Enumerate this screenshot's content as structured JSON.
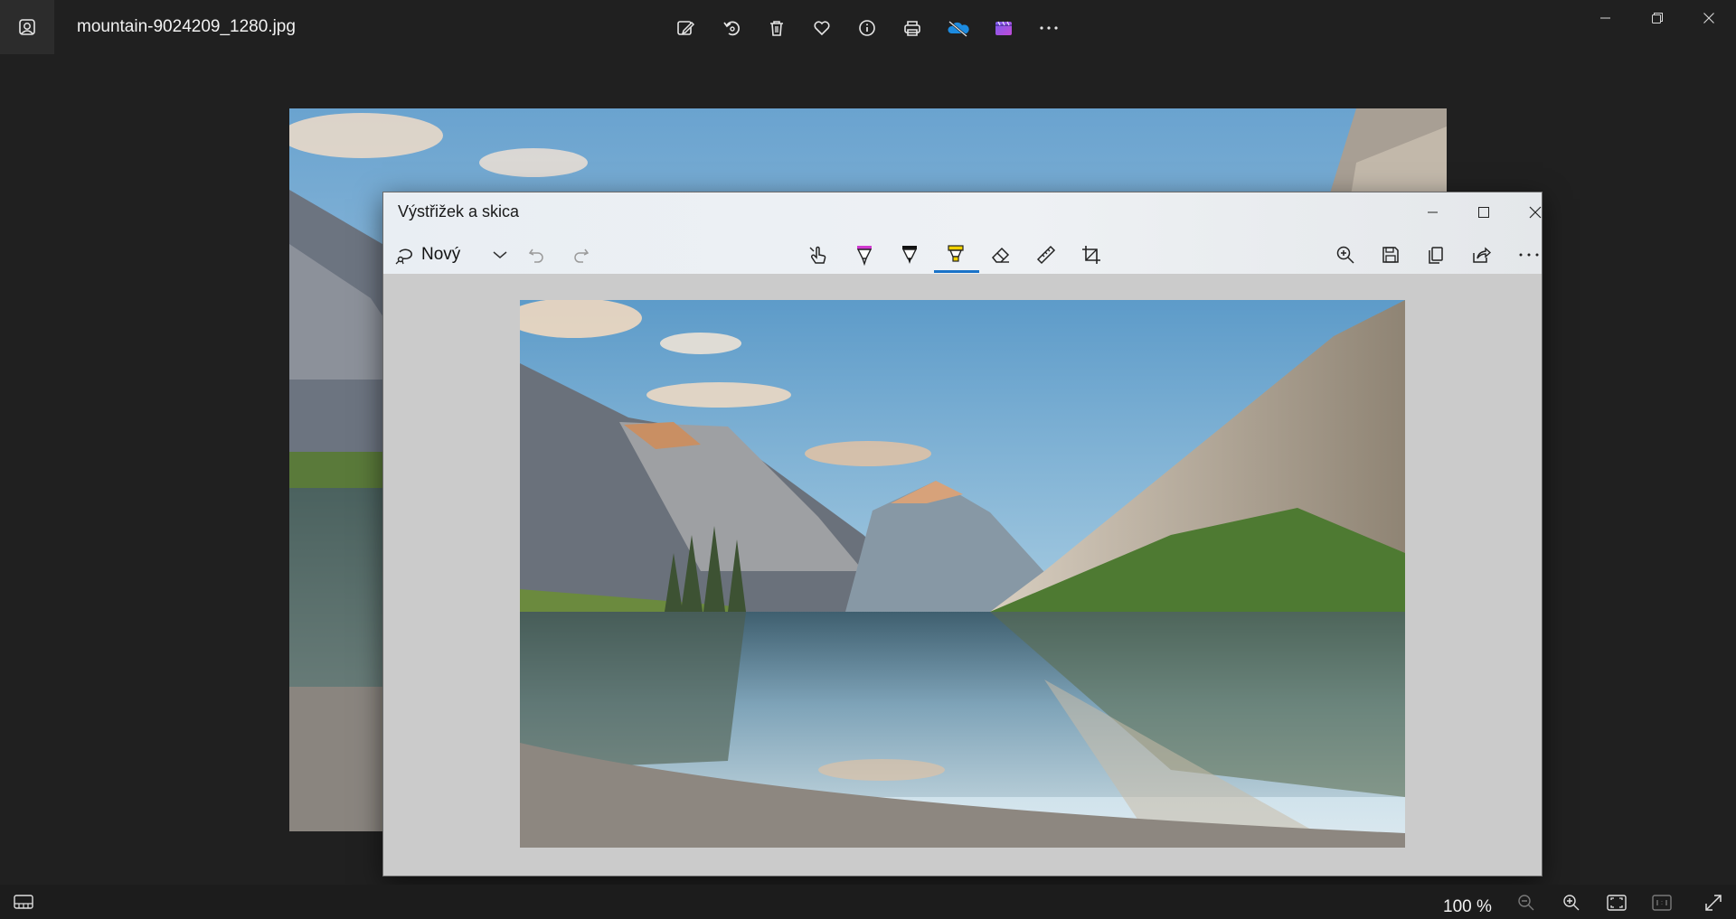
{
  "photos": {
    "file_name": "mountain-9024209_1280.jpg",
    "toolbar": [
      {
        "icon": "edit-image-icon"
      },
      {
        "icon": "rotate-icon"
      },
      {
        "icon": "delete-icon"
      },
      {
        "icon": "favorite-icon"
      },
      {
        "icon": "info-icon"
      },
      {
        "icon": "print-icon"
      },
      {
        "icon": "onedrive-icon"
      },
      {
        "icon": "clipchamp-icon"
      },
      {
        "icon": "more-icon"
      }
    ],
    "window_controls": [
      "minimize-icon",
      "restore-icon",
      "close-icon"
    ],
    "zoom_level": "100 %",
    "accent_onedrive": "#1c8be0"
  },
  "snip": {
    "title": "Výstřižek a skica",
    "new_label": "Nový",
    "tools_left": [
      "undo-icon",
      "redo-icon"
    ],
    "tools_center": [
      "touch-writing-icon",
      "ballpoint-pen-icon",
      "pencil-icon",
      "highlighter-icon",
      "eraser-icon",
      "ruler-icon",
      "crop-icon"
    ],
    "tools_right": [
      "zoom-icon",
      "save-icon",
      "copy-icon",
      "share-icon",
      "more-icon"
    ],
    "active_tool": "highlighter-icon",
    "colors": {
      "pen": "#d13ad1",
      "pencil": "#111111",
      "highlighter": "#f2d100",
      "active_underline": "#1a73c8"
    }
  }
}
